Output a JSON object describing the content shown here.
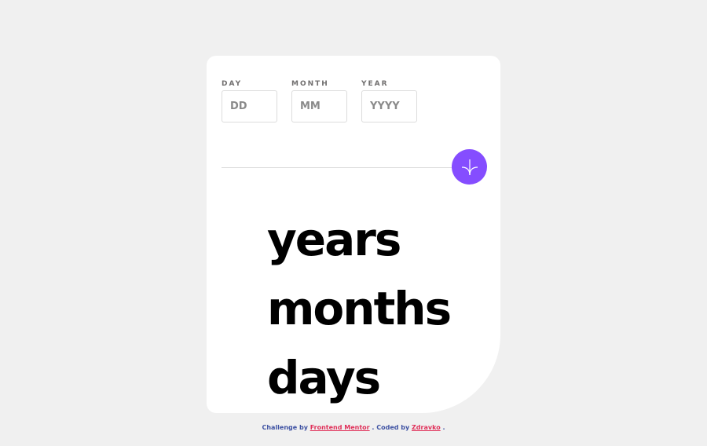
{
  "form": {
    "day": {
      "label": "DAY",
      "placeholder": "DD",
      "value": ""
    },
    "month": {
      "label": "MONTH",
      "placeholder": "MM",
      "value": ""
    },
    "year": {
      "label": "YEAR",
      "placeholder": "YYYY",
      "value": ""
    },
    "submit_icon": "arrow-down-icon"
  },
  "results": {
    "years_label": "years",
    "months_label": "months",
    "days_label": "days"
  },
  "attribution": {
    "challenge_by": "Challenge by",
    "frontend_mentor": "Frontend Mentor",
    "separator": ". Coded by",
    "author": "Zdravko",
    "period": "."
  },
  "colors": {
    "accent": "#854dff",
    "background": "#f0f0f0",
    "card": "#ffffff"
  }
}
